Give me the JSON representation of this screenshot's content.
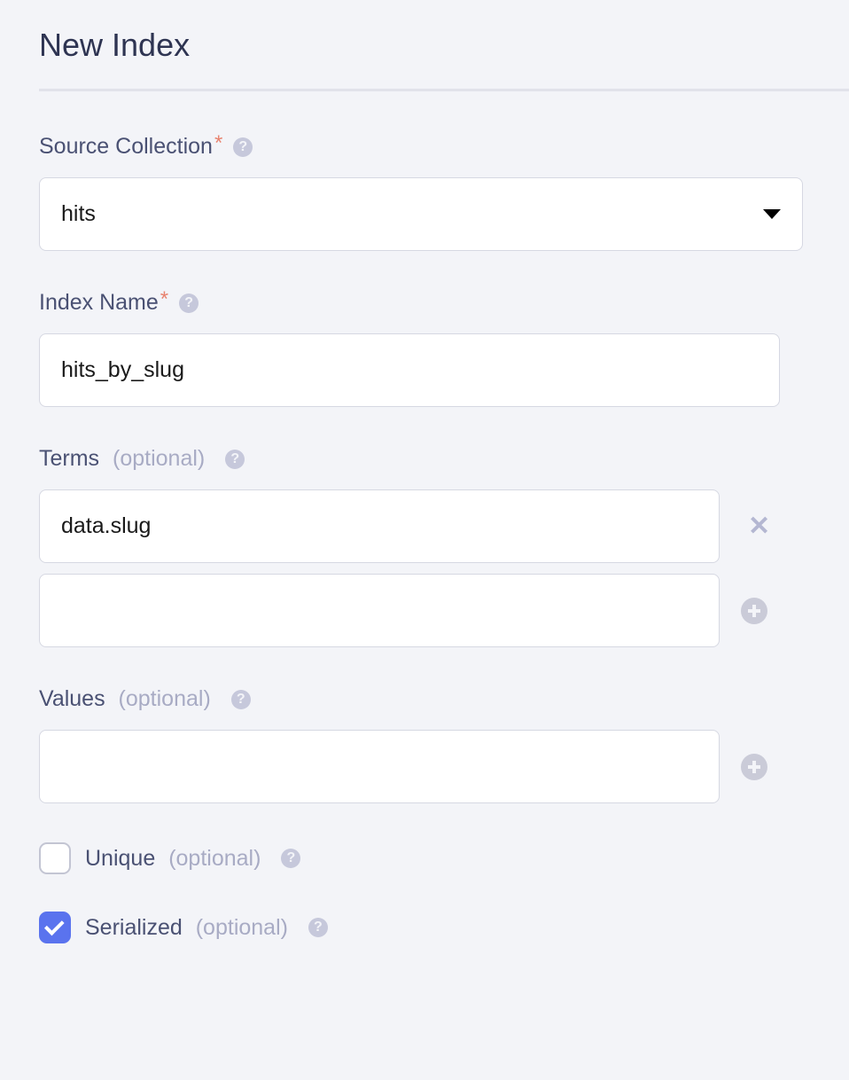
{
  "title": "New Index",
  "sourceCollection": {
    "label": "Source Collection",
    "value": "hits"
  },
  "indexName": {
    "label": "Index Name",
    "value": "hits_by_slug"
  },
  "terms": {
    "label": "Terms",
    "optional": "(optional)",
    "values": [
      "data.slug",
      ""
    ]
  },
  "values": {
    "label": "Values",
    "optional": "(optional)",
    "value": ""
  },
  "unique": {
    "label": "Unique",
    "optional": "(optional)",
    "checked": false
  },
  "serialized": {
    "label": "Serialized",
    "optional": "(optional)",
    "checked": true
  }
}
